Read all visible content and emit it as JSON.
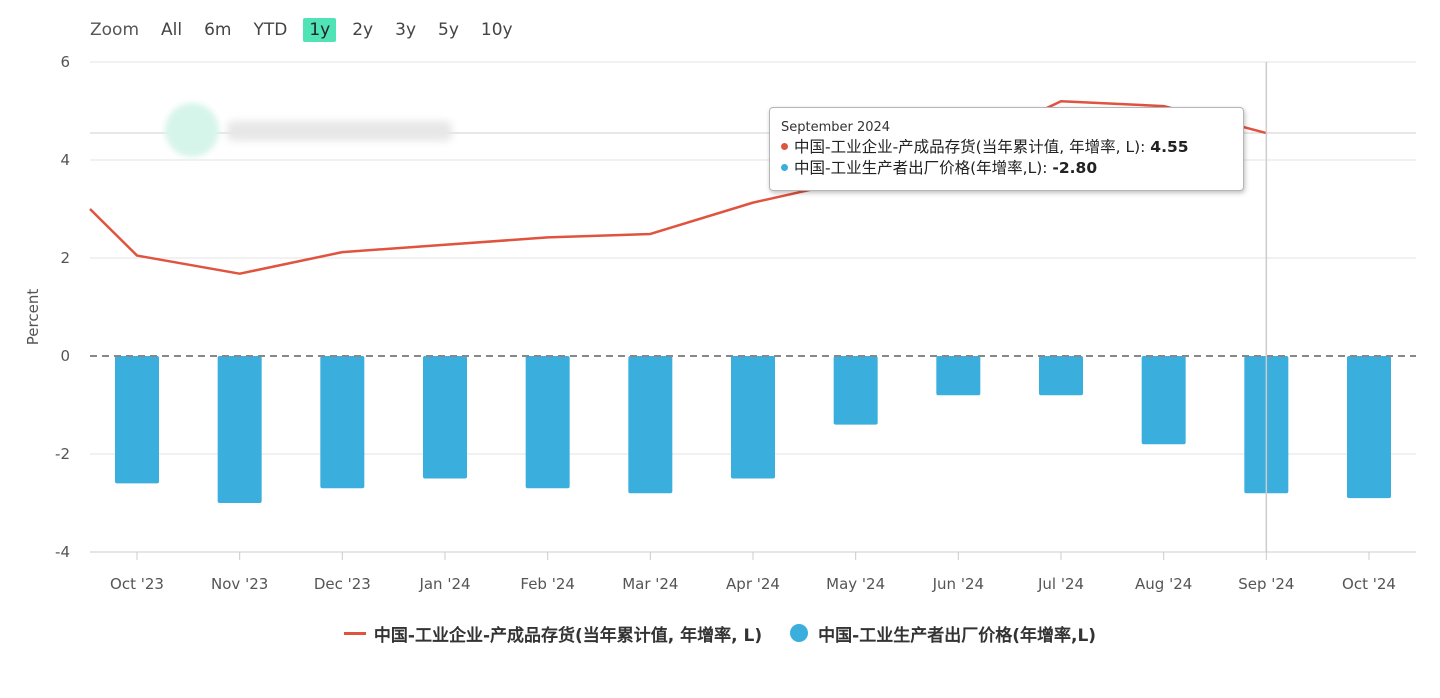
{
  "zoom": {
    "label": "Zoom",
    "buttons": [
      "All",
      "6m",
      "YTD",
      "1y",
      "2y",
      "3y",
      "5y",
      "10y"
    ],
    "active": "1y"
  },
  "tooltip": {
    "title": "September 2024",
    "rows": [
      {
        "name": "中国-工业企业-产成品存货(当年累计值, 年增率, L)",
        "value": "4.55",
        "color": "#e0533f"
      },
      {
        "name": "中国-工业生产者出厂价格(年增率,L)",
        "value": "-2.80",
        "color": "#3aaedc"
      }
    ]
  },
  "chart_data": {
    "type": "bar+line",
    "categories": [
      "Oct '23",
      "Nov '23",
      "Dec '23",
      "Jan '24",
      "Feb '24",
      "Mar '24",
      "Apr '24",
      "May '24",
      "Jun '24",
      "Jul '24",
      "Aug '24",
      "Sep '24",
      "Oct '24"
    ],
    "ylabel": "Percent",
    "ylim": [
      -4,
      6
    ],
    "yticks": [
      -4,
      -2,
      0,
      2,
      4,
      6
    ],
    "series": [
      {
        "name": "中国-工业企业-产成品存货(当年累计值, 年增率, L)",
        "type": "line",
        "color": "#e0533f",
        "start_value": 3.0,
        "values": [
          2.05,
          1.68,
          2.12,
          2.27,
          2.42,
          2.49,
          3.13,
          3.6,
          4.2,
          5.2,
          5.1,
          4.55,
          null
        ]
      },
      {
        "name": "中国-工业生产者出厂价格(年增率,L)",
        "type": "bar",
        "color": "#3aaedc",
        "values": [
          -2.6,
          -3.0,
          -2.7,
          -2.5,
          -2.7,
          -2.8,
          -2.5,
          -1.4,
          -0.8,
          -0.8,
          -1.8,
          -2.8,
          -2.9
        ]
      }
    ],
    "zero_line": "dashed",
    "grid": true,
    "legend_position": "bottom-center",
    "crosshair_category": "Sep '24"
  }
}
